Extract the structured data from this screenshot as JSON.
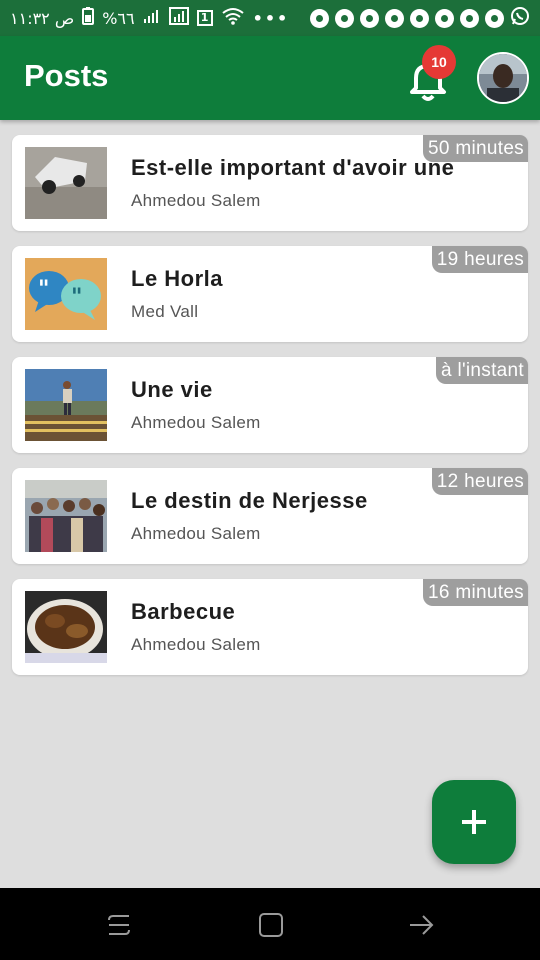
{
  "status_bar": {
    "time": "ص ١١:٣٢",
    "battery": "%٦٦",
    "sim_label": "1",
    "dots": "•••",
    "icons": [
      "battery-icon",
      "signal-icon",
      "sim-icon",
      "wifi-icon",
      "more-dots-icon",
      "chrome-icon",
      "chrome-icon",
      "chrome-icon",
      "chrome-icon",
      "chrome-icon",
      "chrome-icon",
      "chrome-icon",
      "chrome-icon",
      "whatsapp-icon"
    ]
  },
  "app_bar": {
    "title": "Posts",
    "notification_count": "10"
  },
  "posts": [
    {
      "title": "Est-elle important d'avoir une",
      "author": "Ahmedou Salem",
      "time": "50 minutes",
      "thumb": "car"
    },
    {
      "title": "Le Horla",
      "author": "Med Vall",
      "time": "19 heures",
      "thumb": "quotes"
    },
    {
      "title": "Une vie",
      "author": "Ahmedou Salem",
      "time": "à l'instant",
      "thumb": "person"
    },
    {
      "title": "Le destin de Nerjesse",
      "author": "Ahmedou Salem",
      "time": "12 heures",
      "thumb": "group"
    },
    {
      "title": "Barbecue",
      "author": "Ahmedou Salem",
      "time": "16 minutes",
      "thumb": "food"
    }
  ],
  "fab": {
    "icon": "add-icon"
  },
  "nav_bar": {
    "icons": [
      "recent-apps-icon",
      "home-icon",
      "back-icon"
    ]
  },
  "colors": {
    "primary": "#0e7d3b",
    "status_bar": "#1c6f3a",
    "badge": "#e53935",
    "time_chip": "#9e9e9e",
    "background": "#dedede"
  }
}
